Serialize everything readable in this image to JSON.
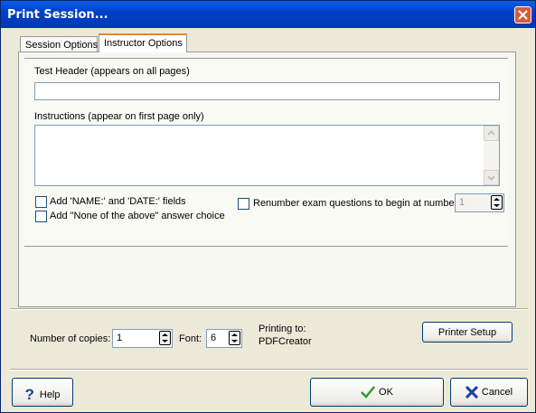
{
  "window": {
    "title": "Print Session..."
  },
  "tabs": [
    {
      "label": "Session Options",
      "underline_char": "S"
    },
    {
      "label": "Instructor Options",
      "active": true
    }
  ],
  "header_field": {
    "label": "Test Header (appears on all pages)",
    "value": ""
  },
  "instructions_field": {
    "label": "Instructions (appear on first page only)",
    "value": ""
  },
  "options": {
    "add_name_date": {
      "label": "Add 'NAME:' and 'DATE:' fields",
      "checked": false
    },
    "add_none_above": {
      "label": "Add \"None of the above\" answer choice",
      "checked": false
    },
    "renumber": {
      "label": "Renumber exam questions to begin at number",
      "checked": false,
      "start_number": "1"
    }
  },
  "print": {
    "copies_label": "Number of copies:",
    "copies_value": "1",
    "font_label": "Font:",
    "font_value": "6",
    "printing_to_label": "Printing to:",
    "printer_name": "PDFCreator",
    "printer_setup_label": "Printer Setup"
  },
  "footer": {
    "help_label": "Help",
    "ok_label": "OK",
    "cancel_label": "Cancel"
  },
  "colors": {
    "titlebar": "#0052e0",
    "dialog_bg": "#ece9d8",
    "ok_check": "#2ea02e",
    "cancel_x": "#1a3f9e",
    "close_btn": "#d75a3a"
  }
}
